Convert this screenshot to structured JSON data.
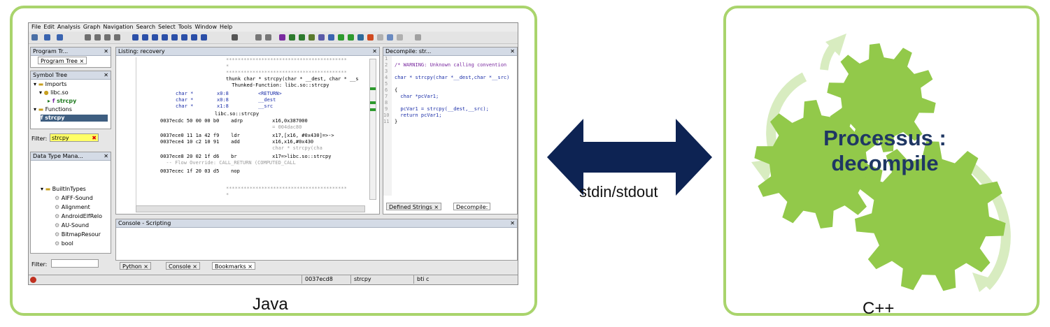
{
  "left_caption": "Java",
  "right_caption": "C++",
  "arrow_label": "stdin/stdout",
  "process_title": "Processus : decompile",
  "colors": {
    "panel_border": "#a9d46c",
    "gear": "#92c94a",
    "gear_arrow": "#d8ecc0",
    "arrow": "#0d2353",
    "title": "#1f3763"
  },
  "ghidra": {
    "menu": [
      "File",
      "Edit",
      "Analysis",
      "Graph",
      "Navigation",
      "Search",
      "Select",
      "Tools",
      "Window",
      "Help"
    ],
    "program_tree_title": "Program Tr...",
    "program_tree_tab": "Program Tree",
    "symbol_tree_title": "Symbol Tree",
    "symbols": {
      "imports": "Imports",
      "lib": "libc.so",
      "func": "strcpy",
      "functions": "Functions",
      "func2": "strcpy"
    },
    "filter_label": "Filter:",
    "filter_value": "strcpy",
    "data_type_title": "Data Type Mana...",
    "data_types": [
      "BuiltInTypes",
      "AIFF-Sound",
      "Alignment",
      "AndroidElfRelo",
      "AU-Sound",
      "BitmapResour",
      "bool"
    ],
    "filter2_label": "Filter:",
    "listing_title": "Listing: recovery",
    "listing_lines": [
      "*****************************************",
      "*",
      "*****************************************",
      "thunk char * strcpy(char * __dest, char * __s",
      "  Thunked-Function: libc.so::strcpy",
      "char *        x0:8          <RETURN>",
      "char *        x0:8          __dest",
      "char *        x1:8          __src",
      "libc.so::strcpy",
      "0037ecdc 50 00 00 b0    adrp          x16,0x387000",
      "                                      = 004dac80",
      "0037ece0 11 1a 42 f9    ldr           x17,[x16, #0x430]=>->",
      "0037ece4 10 c2 10 91    add           x16,x16,#0x430",
      "                                      char * strcpy(cha",
      "0037ece8 20 02 1f d6    br            x17=>libc.so::strcpy",
      "  -- Flow Override: CALL_RETURN (COMPUTED_CALL",
      "0037ecec 1f 20 03 d5    nop",
      "*****************************************",
      "*"
    ],
    "decompile_title": "Decompile: str...",
    "decompile_lines": [
      "/* WARNING: Unknown calling convention",
      "",
      "char * strcpy(char *__dest,char *__src)",
      "",
      "{",
      "  char *pcVar1;",
      "",
      "  pcVar1 = strcpy(__dest,__src);",
      "  return pcVar1;",
      "}"
    ],
    "decompile_line_numbers": [
      "1",
      "2",
      "3",
      "4",
      "5",
      "6",
      "7",
      "8",
      "9",
      "10",
      "11"
    ],
    "bottom_tabs": [
      "Defined Strings",
      "Decompile:"
    ],
    "console_title": "Console - Scripting",
    "console_tabs": [
      "Python",
      "Console",
      "Bookmarks"
    ],
    "status": [
      "0037ecd8",
      "strcpy",
      "bti c"
    ]
  }
}
